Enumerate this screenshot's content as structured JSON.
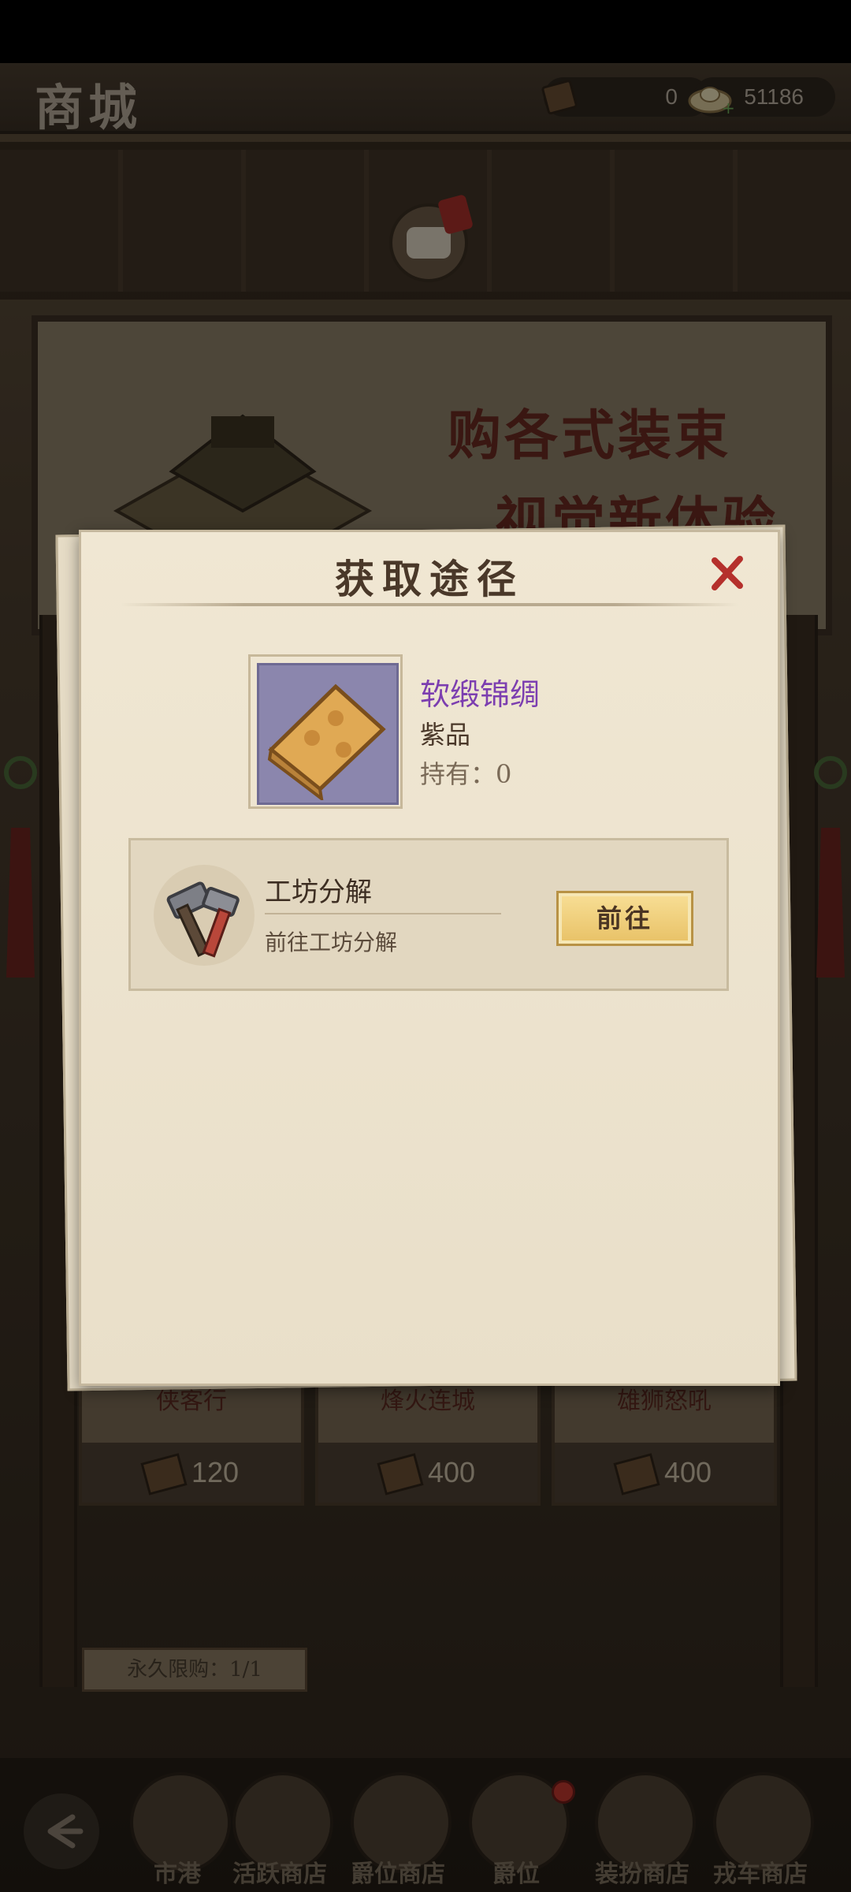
{
  "header": {
    "title": "商城",
    "currency_token": "0",
    "currency_gold": "51186"
  },
  "banner": {
    "line1": "购各式装束",
    "line2": "视觉新体验"
  },
  "shop_cards": [
    {
      "name": "侠客行",
      "price": "120"
    },
    {
      "name": "烽火连城",
      "price": "400"
    },
    {
      "name": "雄狮怒吼",
      "price": "400"
    }
  ],
  "limit_tab": "永久限购：1/1",
  "bottom_nav": [
    {
      "label": "市港"
    },
    {
      "label": "活跃商店"
    },
    {
      "label": "爵位商店"
    },
    {
      "label": "爵位"
    },
    {
      "label": "装扮商店"
    },
    {
      "label": "戎车商店"
    }
  ],
  "dialog": {
    "title": "获取途径",
    "item": {
      "name": "软缎锦绸",
      "grade": "紫品",
      "owned": "持有：0"
    },
    "source": {
      "name": "工坊分解",
      "description": "前往工坊分解",
      "button": "前往"
    }
  },
  "colors": {
    "item_name": "#7c3eb0",
    "button_gold": "#e8c166",
    "close_red": "#b5302c"
  }
}
